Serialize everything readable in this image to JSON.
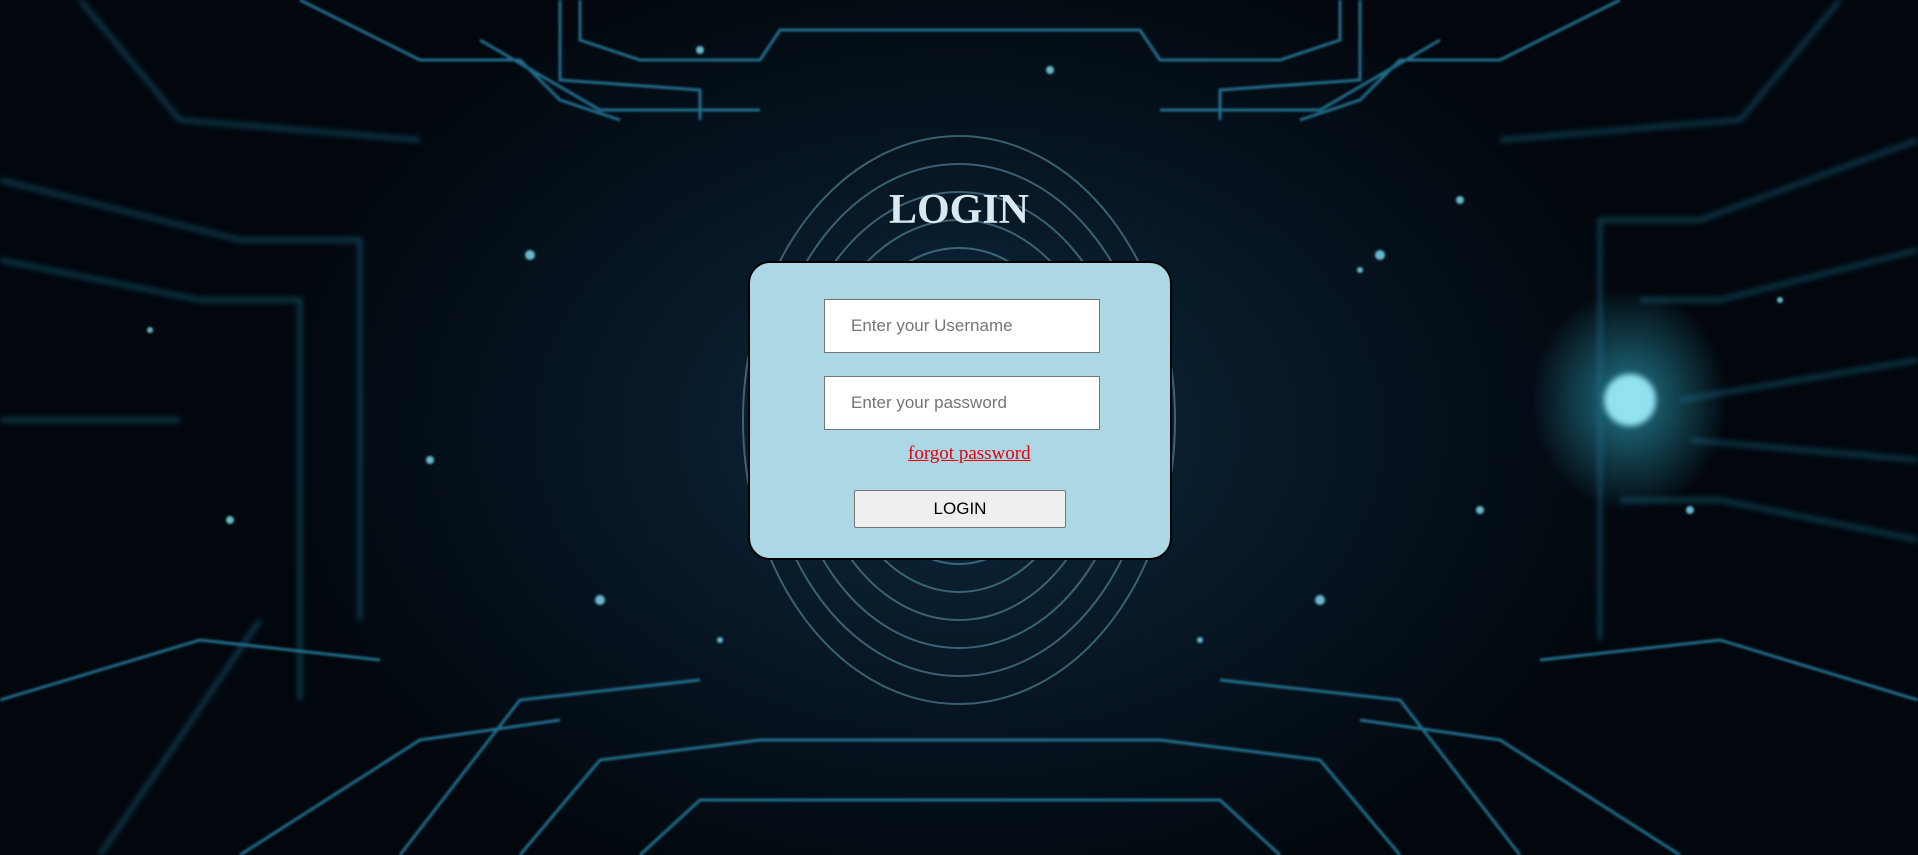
{
  "page": {
    "title": "LOGIN"
  },
  "form": {
    "username_placeholder": "Enter your Username",
    "username_value": "",
    "password_placeholder": "Enter your password",
    "password_value": "",
    "forgot_label": "forgot password",
    "submit_label": "LOGIN"
  },
  "colors": {
    "card_background": "#acd7e4",
    "forgot_link": "#e8000b",
    "title": "#d9e9f0",
    "background_glow": "#2fb8d8"
  },
  "background": {
    "icon": "fingerprint-circuit-icon"
  }
}
